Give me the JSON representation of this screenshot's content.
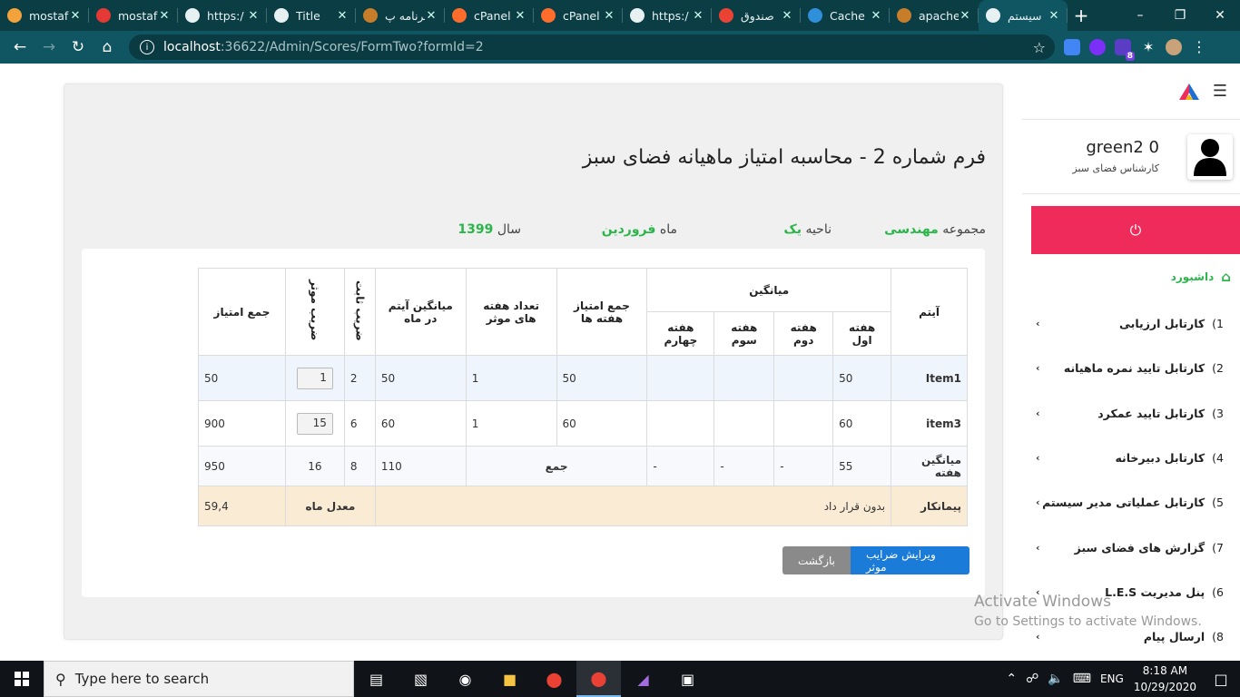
{
  "browser": {
    "tabs": [
      {
        "title": "mostaf",
        "color": "#f4a33c"
      },
      {
        "title": "mostaf",
        "color": "#e53935"
      },
      {
        "title": "https:/",
        "color": "#e8f1f2"
      },
      {
        "title": "Title",
        "color": "#e8f1f2"
      },
      {
        "title": "برنامه پ",
        "color": "#c77d2a"
      },
      {
        "title": "cPanel",
        "color": "#ff6c2c"
      },
      {
        "title": "cPanel",
        "color": "#ff6c2c"
      },
      {
        "title": "https:/",
        "color": "#e8f1f2"
      },
      {
        "title": "صندوق",
        "color": "#ea4335"
      },
      {
        "title": "Cache",
        "color": "#2f8fd8"
      },
      {
        "title": "apache",
        "color": "#c77d2a"
      },
      {
        "title": "سیستم",
        "color": "#e8f1f2"
      }
    ],
    "url_host": "localhost",
    "url_path": ":36622/Admin/Scores/FormTwo?formId=2",
    "ext_badge": "8"
  },
  "form": {
    "title": "فرم شماره 2 - محاسبه امتیاز ماهیانه فضای سبز",
    "meta": {
      "group_label": "مجموعه",
      "group_value": "مهندسی",
      "region_label": "ناحیه",
      "region_value": "یک",
      "month_label": "ماه",
      "month_value": "فروردین",
      "year_label": "سال",
      "year_value": "1399"
    },
    "headers": {
      "item": "آیتم",
      "avg": "میانگین",
      "w1": "هفته اول",
      "w2": "هفته دوم",
      "w3": "هفته سوم",
      "w4": "هفته چهارم",
      "week_sum": "جمع امتیاز هفته ها",
      "eff_weeks": "تعداد هفته های موثر",
      "item_avg": "میانگین آیتم در ماه",
      "fixed": "ضریب ثابت",
      "effective": "ضریب موثر",
      "total": "جمع امتیاز"
    },
    "rows": [
      {
        "item": "Item1",
        "w1": "50",
        "w2": "",
        "w3": "",
        "w4": "",
        "week_sum": "50",
        "eff_weeks": "1",
        "item_avg": "50",
        "fixed": "2",
        "effective": "1",
        "total": "50"
      },
      {
        "item": "item3",
        "w1": "60",
        "w2": "",
        "w3": "",
        "w4": "",
        "week_sum": "60",
        "eff_weeks": "1",
        "item_avg": "60",
        "fixed": "6",
        "effective": "15",
        "total": "900"
      }
    ],
    "weekly_avg": {
      "label": "میانگین هفته",
      "w1": "55",
      "w2": "-",
      "w3": "-",
      "w4": "-",
      "sum_label": "جمع",
      "item_avg": "110",
      "fixed": "8",
      "effective": "16",
      "total": "950"
    },
    "contractor": {
      "label": "پیمانکار",
      "value": "بدون قرار داد",
      "avg_label": "معدل ماه",
      "avg_value": "59,4"
    },
    "buttons": {
      "edit": "ویرایش ضرایب موثر",
      "back": "بازگشت"
    }
  },
  "sidebar": {
    "user_name": "green2 0",
    "user_role": "کارشناس فضای سبز",
    "dashboard": "داشبورد",
    "items": [
      {
        "num": "1)",
        "label": "کارتابل ارزیابی"
      },
      {
        "num": "2)",
        "label": "کارتابل تایید نمره ماهیانه"
      },
      {
        "num": "3)",
        "label": "کارتابل تایید عمکرد"
      },
      {
        "num": "4)",
        "label": "کارتابل دبیرخانه"
      },
      {
        "num": "5)",
        "label": "کارتابل عملیاتی مدیر سیستم"
      },
      {
        "num": "7)",
        "label": "گزارش های فضای سبز"
      },
      {
        "num": "6)",
        "label": "پنل مدیریت L.E.S"
      },
      {
        "num": "8)",
        "label": "ارسال پیام"
      }
    ]
  },
  "watermark": {
    "line1": "Activate Windows",
    "line2": "Go to Settings to activate Windows."
  },
  "taskbar": {
    "search_placeholder": "Type here to search",
    "lang": "ENG",
    "time": "8:18 AM",
    "date": "10/29/2020"
  }
}
